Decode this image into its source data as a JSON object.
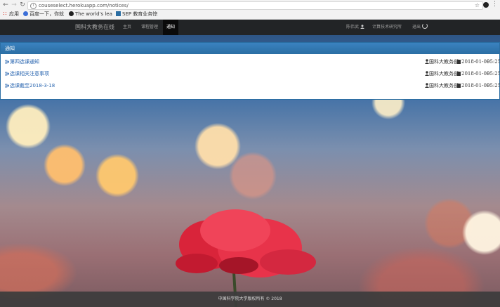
{
  "browser": {
    "url": "couseselect.herokuapp.com/notices/",
    "bookmarks": [
      "应用",
      "百度一下，你就",
      "The world's lea",
      "SEP 教育业务惊"
    ]
  },
  "navbar": {
    "brand": "国科大教务在线",
    "links": [
      "主页",
      "课程管理",
      "通知"
    ],
    "active": "通知",
    "right_links": [
      "陈伟武",
      "计算技术研究所",
      "退出"
    ]
  },
  "panel": {
    "title": "通知",
    "notices": [
      {
        "title": "第四选课通知",
        "author": "国科大教务部",
        "date": "2018-01-09",
        "time": "05:25"
      },
      {
        "title": "选课相关注意事项",
        "author": "国科大教务部",
        "date": "2018-01-09",
        "time": "05:25"
      },
      {
        "title": "选课截至2018-3-18",
        "author": "国科大教务部",
        "date": "2018-01-09",
        "time": "05:25"
      }
    ]
  },
  "footer": {
    "text": "中国科学院大学版权所有 © 2018"
  },
  "colors": {
    "navbar": "#222222",
    "panel_header": "#2b6ea3",
    "link": "#2a66b0"
  }
}
